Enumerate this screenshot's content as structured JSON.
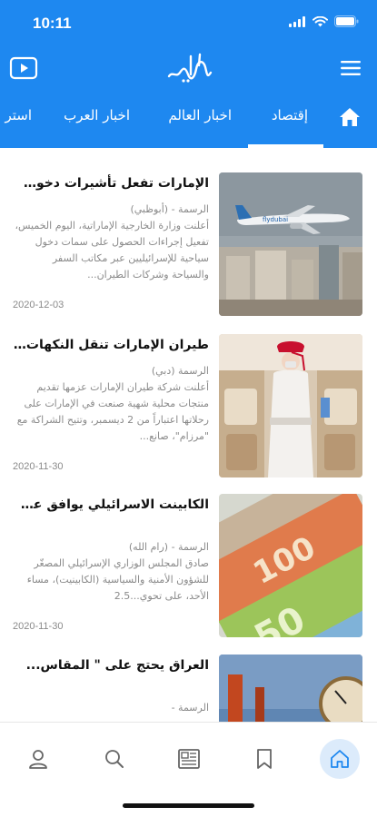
{
  "status": {
    "time": "10:11"
  },
  "app": {
    "logo_text": "الرسمة"
  },
  "tabs": [
    {
      "label": "إقتصاد"
    },
    {
      "label": "اخبار العالم"
    },
    {
      "label": "اخبار العرب"
    },
    {
      "label": "استر"
    }
  ],
  "articles": [
    {
      "title": "الإمارات تفعل تأشيرات دخول...",
      "source": "الرسمة - (أبوظبي)",
      "summary": "أعلنت وزارة الخارجية الإماراتية، اليوم الخميس، تفعيل إجراءات الحصول على سمات دخول سياحية للإسرائيليين عبر مكاتب السفر والسياحة وشركات الطيران...",
      "date": "2020-12-03"
    },
    {
      "title": "طيران الإمارات تنقل النكهات...",
      "source": "الرسمة (دبي)",
      "summary": "أعلنت شركة طيران الإمارات عزمها تقديم منتجات محلية شهية صنعت في الإمارات على رحلاتها اعتباراً من 2 ديسمبر، وتتيح الشراكة مع \"مرزام\"، صانع...",
      "date": "2020-11-30"
    },
    {
      "title": "الكابينت الاسرائيلي يوافق عل...",
      "source": "الرسمة - (رام الله)",
      "summary": "صادق المجلس الوزاري الإسرائيلي المصغّر للشؤون الأمنية والسياسية (الكابينيت)، مساء الأحد، على تحوي...2.5",
      "date": "2020-11-30"
    },
    {
      "title": "العراق يحتج على \" المقاس...",
      "source": "الرسمة -",
      "summary": "",
      "date": ""
    }
  ],
  "bottom_nav": [
    {
      "icon": "home-icon",
      "active": true
    },
    {
      "icon": "bookmark-icon",
      "active": false
    },
    {
      "icon": "newspaper-icon",
      "active": false
    },
    {
      "icon": "search-icon",
      "active": false
    },
    {
      "icon": "profile-icon",
      "active": false
    }
  ],
  "colors": {
    "brand": "#1e88f0",
    "nav_active_bg": "#dcebfb",
    "nav_icon": "#666666"
  }
}
